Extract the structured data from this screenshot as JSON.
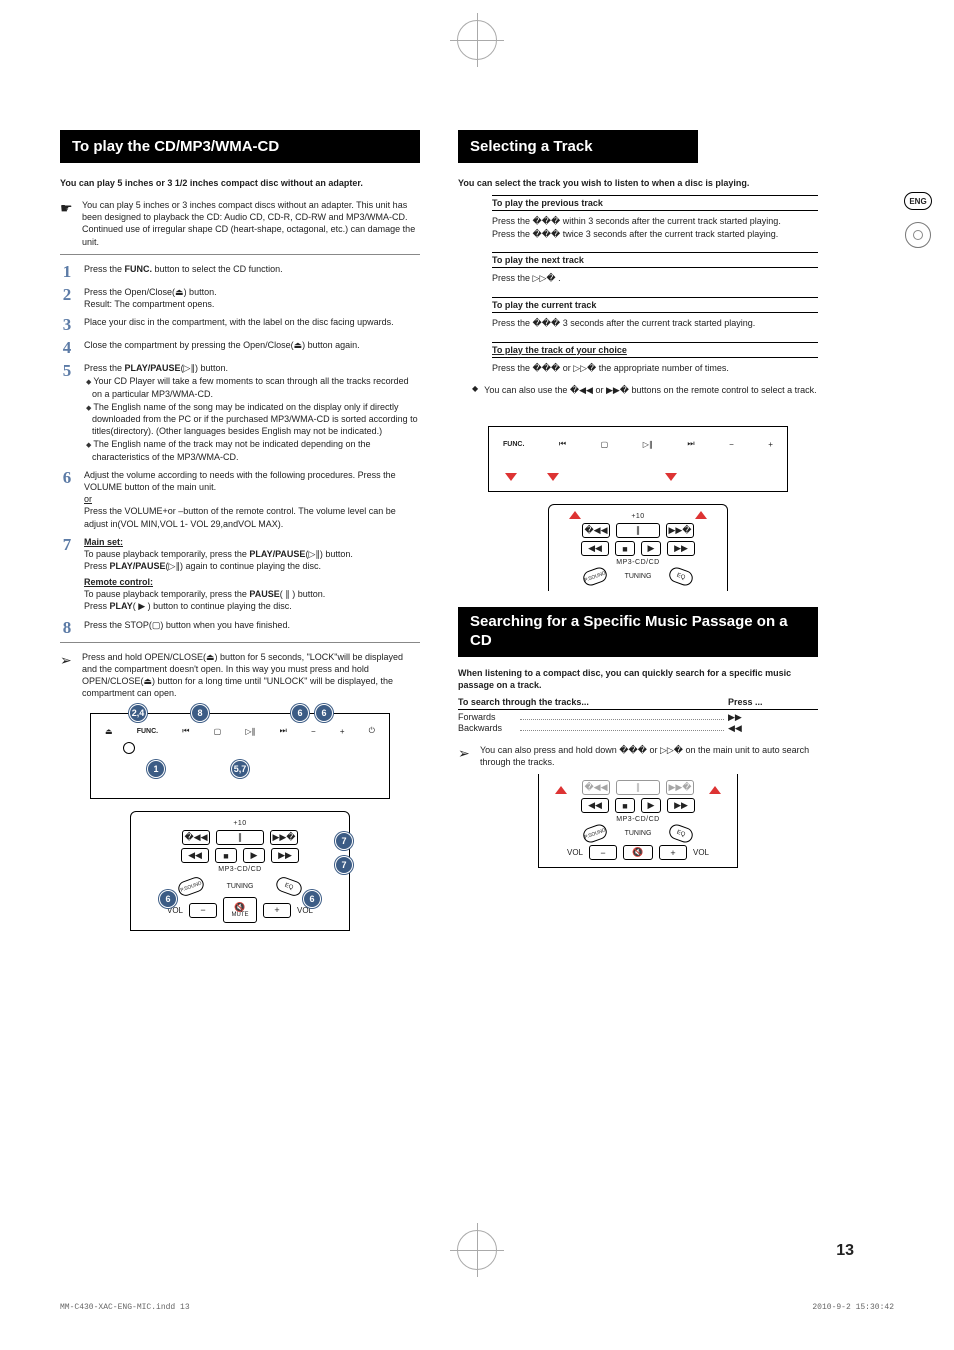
{
  "lang_tab": "ENG",
  "left": {
    "title": "To play the CD/MP3/WMA-CD",
    "intro": "You can play 5 inches or 3 1/2 inches compact disc without an adapter.",
    "note1": "You can play 5 inches or 3 inches compact discs without an adapter. This unit has been designed to playback the CD: Audio CD, CD-R, CD-RW and MP3/WMA-CD.",
    "note2": "Continued use of irregular shape CD (heart-shape, octagonal, etc.) can damage the unit.",
    "step1_a": "Press the ",
    "step1_b": "FUNC.",
    "step1_c": " button to select the CD function.",
    "step2_a": "Press the Open/Close(",
    "step2_b": ") button.",
    "step2_r": "Result: The compartment opens.",
    "eject": "⏏",
    "step3": "Place your disc in the compartment, with the label on the disc facing upwards.",
    "step4_a": "Close the compartment by pressing the Open/Close(",
    "step4_b": ") button again.",
    "step5_a": "Press the ",
    "step5_b": "PLAY/PAUSE",
    "step5_c": "(▷∥) button.",
    "step5_s1": "Your CD Player will take a few moments to scan through all the tracks recorded on a particular MP3/WMA-CD.",
    "step5_s2": "The English name of the song may be indicated on the display only if directly downloaded from the PC or if the purchased MP3/WMA-CD is sorted according to titles(directory). (Other languages besides English may not be indicated.)",
    "step5_s3": "The English name of the track may not be indicated depending on the characteristics of the MP3/WMA-CD.",
    "step6_a": "Adjust the volume according to needs with the following procedures. Press the VOLUME button of the main unit.",
    "step6_or": "or",
    "step6_b": "Press the VOLUME+or –button of the remote control. The volume level can be adjust in(VOL MIN,VOL 1- VOL 29,andVOL MAX).",
    "step7_h1": "Main set:",
    "step7_l1a": "To pause playback temporarily, press the ",
    "step7_l1b": "PLAY/PAUSE",
    "step7_l1c": "(▷∥) button.",
    "step7_l2a": "Press ",
    "step7_l2b": "PLAY/PAUSE",
    "step7_l2c": "(▷∥) again to continue playing the disc.",
    "step7_h2": "Remote control:",
    "step7_l3a": "To pause playback temporarily, press the ",
    "step7_l3b": "PAUSE",
    "step7_l3c": "( ∥ ) button.",
    "step7_l4a": "Press ",
    "step7_l4b": "PLAY",
    "step7_l4c": "( ▶ ) button to continue playing the disc.",
    "step8": "Press the STOP(▢) button when you have finished.",
    "tip": "Press and hold OPEN/CLOSE(⏏) button for 5 seconds, \"LOCK\"will be displayed and the compartment doesn't open. In this way you must press and hold OPEN/CLOSE(⏏) button for a long time until \"UNLOCK\" will be displayed, the compartment can open.",
    "diag": {
      "func": "FUNC.",
      "c24": "2,4",
      "c8": "8",
      "c6a": "6",
      "c6b": "6",
      "c1": "1",
      "c57": "5,7"
    },
    "remote": {
      "plus10": "+10",
      "mp3": "MP3-CD/CD",
      "c7a": "7",
      "c7b": "7",
      "c6a": "6",
      "c6b": "6",
      "vol": "VOL",
      "mute": "MUTE",
      "mute_icon": "🔇",
      "tuning": "TUNING",
      "psound": "P.SOUND",
      "eq": "EQ"
    }
  },
  "right": {
    "title": "Selecting a Track",
    "intro": "You can select the track you wish to listen to when a disc is playing.",
    "s1h": "To play the previous track",
    "s1a": "Press the  ���  within 3 seconds after the current track started playing.",
    "s1b": "Press the  ���  twice 3 seconds after the current track started playing.",
    "s2h": "To play the next track",
    "s2a": "Press the   ▷▷� .",
    "s3h": "To play the current track",
    "s3a": "Press the  ���  3 seconds after the current track started playing.",
    "s4h": "To play the track of your choice",
    "s4a": "Press the  ���  or  ▷▷�   the appropriate number of times.",
    "tip": "You can also use the  �◀◀  or  ▶▶�  buttons on the remote control to select a track.",
    "diag": {
      "func": "FUNC."
    },
    "remote": {
      "plus10": "+10",
      "mp3": "MP3-CD/CD",
      "tuning": "TUNING",
      "psound": "P.SOUND",
      "eq": "EQ"
    },
    "search_title": "Searching for a Specific Music Passage on a CD",
    "search_intro": "When listening to a compact disc, you can quickly search for a specific music passage on a track.",
    "tbl_h1": "To search through the tracks...",
    "tbl_h2": "Press ...",
    "fwd": "Forwards",
    "bwd": "Backwards",
    "fwd_sym": "▶▶",
    "bwd_sym": "◀◀",
    "search_tip": "You can also press and hold down  ���  or  ▷▷�   on the main unit to auto  search through the tracks.",
    "remote2": {
      "mp3": "MP3-CD/CD",
      "tuning": "TUNING",
      "psound": "P.SOUND",
      "eq": "EQ",
      "vol": "VOL",
      "mute_icon": "🔇"
    }
  },
  "page_num": "13",
  "footer_left": "MM-C430-XAC-ENG-MIC.indd   13",
  "footer_right": "2010-9-2   15:30:42"
}
